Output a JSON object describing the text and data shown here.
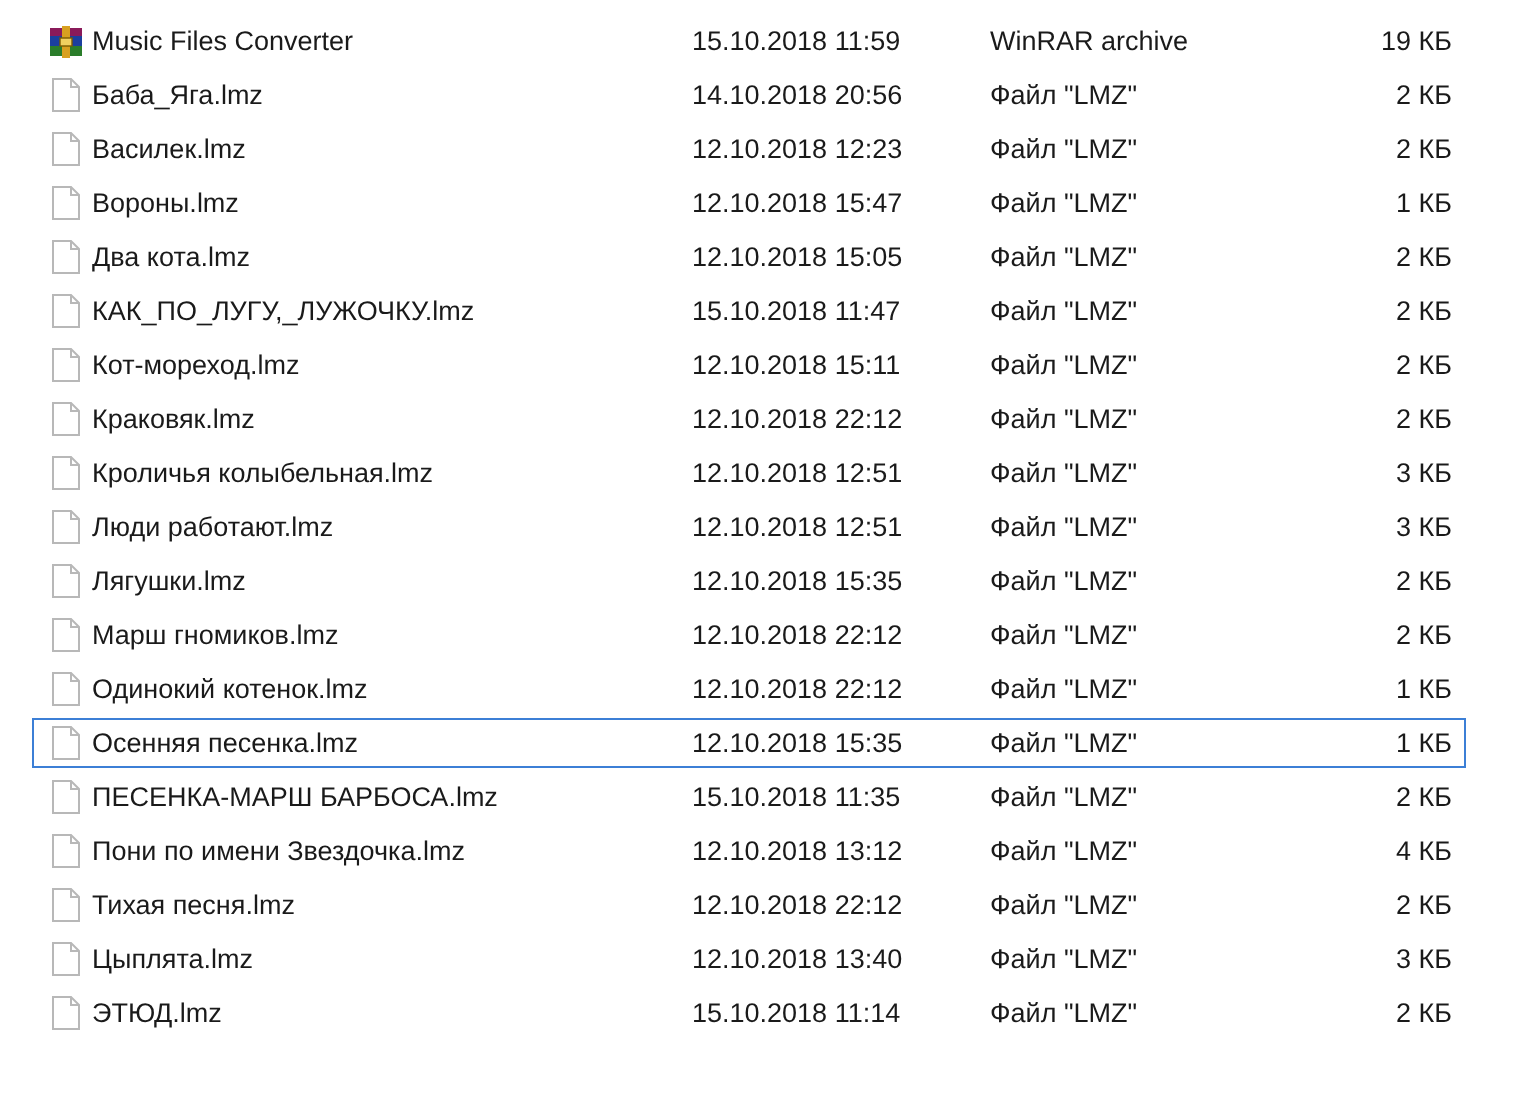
{
  "files": [
    {
      "kind": "archive",
      "name": "Music Files Converter",
      "date": "15.10.2018 11:59",
      "type": "WinRAR archive",
      "size": "19 КБ",
      "focused": false
    },
    {
      "kind": "file",
      "name": "Баба_Яга.lmz",
      "date": "14.10.2018 20:56",
      "type": "Файл \"LMZ\"",
      "size": "2 КБ",
      "focused": false
    },
    {
      "kind": "file",
      "name": "Василек.lmz",
      "date": "12.10.2018 12:23",
      "type": "Файл \"LMZ\"",
      "size": "2 КБ",
      "focused": false
    },
    {
      "kind": "file",
      "name": "Вороны.lmz",
      "date": "12.10.2018 15:47",
      "type": "Файл \"LMZ\"",
      "size": "1 КБ",
      "focused": false
    },
    {
      "kind": "file",
      "name": "Два кота.lmz",
      "date": "12.10.2018 15:05",
      "type": "Файл \"LMZ\"",
      "size": "2 КБ",
      "focused": false
    },
    {
      "kind": "file",
      "name": "КАК_ПО_ЛУГУ,_ЛУЖОЧКУ.lmz",
      "date": "15.10.2018 11:47",
      "type": "Файл \"LMZ\"",
      "size": "2 КБ",
      "focused": false
    },
    {
      "kind": "file",
      "name": "Кот-мореход.lmz",
      "date": "12.10.2018 15:11",
      "type": "Файл \"LMZ\"",
      "size": "2 КБ",
      "focused": false
    },
    {
      "kind": "file",
      "name": "Краковяк.lmz",
      "date": "12.10.2018 22:12",
      "type": "Файл \"LMZ\"",
      "size": "2 КБ",
      "focused": false
    },
    {
      "kind": "file",
      "name": "Кроличья колыбельная.lmz",
      "date": "12.10.2018 12:51",
      "type": "Файл \"LMZ\"",
      "size": "3 КБ",
      "focused": false
    },
    {
      "kind": "file",
      "name": "Люди работают.lmz",
      "date": "12.10.2018 12:51",
      "type": "Файл \"LMZ\"",
      "size": "3 КБ",
      "focused": false
    },
    {
      "kind": "file",
      "name": "Лягушки.lmz",
      "date": "12.10.2018 15:35",
      "type": "Файл \"LMZ\"",
      "size": "2 КБ",
      "focused": false
    },
    {
      "kind": "file",
      "name": "Марш гномиков.lmz",
      "date": "12.10.2018 22:12",
      "type": "Файл \"LMZ\"",
      "size": "2 КБ",
      "focused": false
    },
    {
      "kind": "file",
      "name": "Одинокий котенок.lmz",
      "date": "12.10.2018 22:12",
      "type": "Файл \"LMZ\"",
      "size": "1 КБ",
      "focused": false
    },
    {
      "kind": "file",
      "name": "Осенняя песенка.lmz",
      "date": "12.10.2018 15:35",
      "type": "Файл \"LMZ\"",
      "size": "1 КБ",
      "focused": true
    },
    {
      "kind": "file",
      "name": "ПЕСЕНКА-МАРШ БАРБОСА.lmz",
      "date": "15.10.2018 11:35",
      "type": "Файл \"LMZ\"",
      "size": "2 КБ",
      "focused": false
    },
    {
      "kind": "file",
      "name": "Пони по имени Звездочка.lmz",
      "date": "12.10.2018 13:12",
      "type": "Файл \"LMZ\"",
      "size": "4 КБ",
      "focused": false
    },
    {
      "kind": "file",
      "name": "Тихая песня.lmz",
      "date": "12.10.2018 22:12",
      "type": "Файл \"LMZ\"",
      "size": "2 КБ",
      "focused": false
    },
    {
      "kind": "file",
      "name": "Цыплята.lmz",
      "date": "12.10.2018 13:40",
      "type": "Файл \"LMZ\"",
      "size": "3 КБ",
      "focused": false
    },
    {
      "kind": "file",
      "name": "ЭТЮД.lmz",
      "date": "15.10.2018 11:14",
      "type": "Файл \"LMZ\"",
      "size": "2 КБ",
      "focused": false
    }
  ]
}
